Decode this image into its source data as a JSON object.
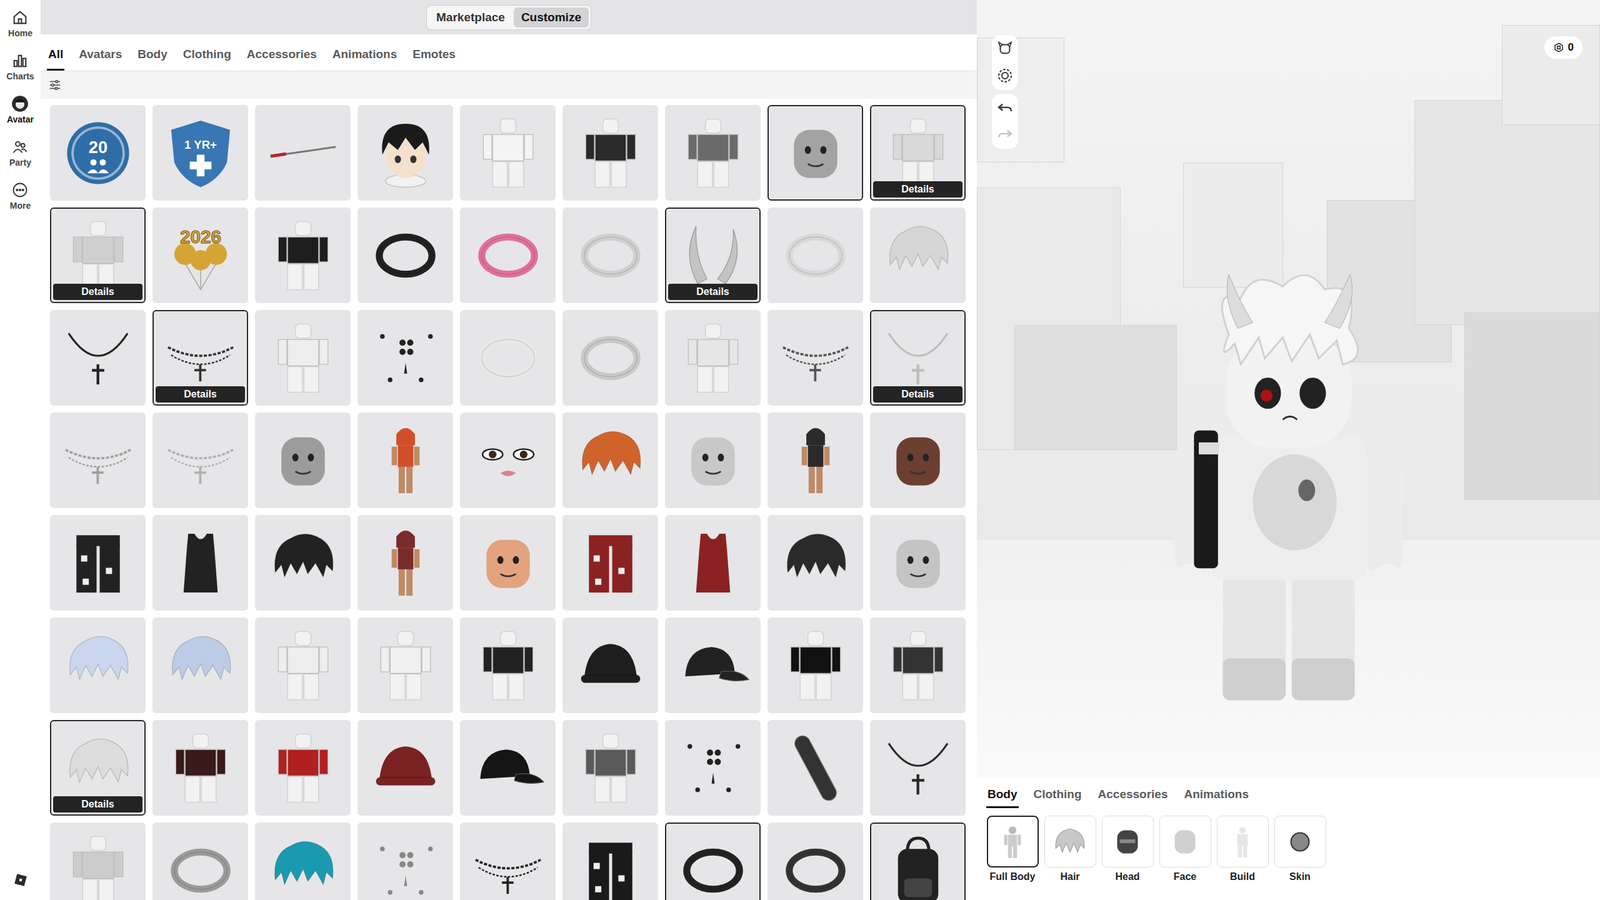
{
  "nav": {
    "items": [
      {
        "label": "Home",
        "kind": "home",
        "selected": false
      },
      {
        "label": "Charts",
        "kind": "charts",
        "selected": false
      },
      {
        "label": "Avatar",
        "kind": "avatar",
        "selected": true
      },
      {
        "label": "Party",
        "kind": "party",
        "selected": false
      },
      {
        "label": "More",
        "kind": "more",
        "selected": false
      }
    ]
  },
  "mode_toggle": [
    {
      "label": "Marketplace",
      "selected": false
    },
    {
      "label": "Customize",
      "selected": true
    }
  ],
  "tabs": [
    {
      "label": "All",
      "selected": true
    },
    {
      "label": "Avatars",
      "selected": false
    },
    {
      "label": "Body",
      "selected": false
    },
    {
      "label": "Clothing",
      "selected": false
    },
    {
      "label": "Accessories",
      "selected": false
    },
    {
      "label": "Animations",
      "selected": false
    },
    {
      "label": "Emotes",
      "selected": false
    }
  ],
  "grid": {
    "items": [
      {
        "kind": "coin",
        "color": "#2f6da6",
        "label": "20",
        "selected": false
      },
      {
        "kind": "shield",
        "color": "#3876b4",
        "label": "1 YR+",
        "selected": false
      },
      {
        "kind": "sword",
        "color": "#b02a2a",
        "selected": false
      },
      {
        "kind": "anime",
        "color": "#1a1a1a",
        "selected": false
      },
      {
        "kind": "avatar",
        "color": "#f4f4f4",
        "selected": false
      },
      {
        "kind": "avatar",
        "color": "#2a2a2a",
        "selected": false
      },
      {
        "kind": "avatar",
        "color": "#6a6a6a",
        "selected": false
      },
      {
        "kind": "head",
        "color": "#a3a3a3",
        "selected": true
      },
      {
        "kind": "avatar",
        "color": "#d9d9d9",
        "selected": true,
        "badge": "Details"
      },
      {
        "kind": "avatar",
        "color": "#cfcfcf",
        "selected": true,
        "badge": "Details"
      },
      {
        "kind": "balloons",
        "color": "#d4a535",
        "label": "2026",
        "selected": false
      },
      {
        "kind": "avatar",
        "color": "#1e1e1e",
        "selected": false
      },
      {
        "kind": "accessory",
        "color": "#222222",
        "selected": false
      },
      {
        "kind": "accessory",
        "color": "#e0709a",
        "selected": false
      },
      {
        "kind": "accessory",
        "color": "#cfcfcf",
        "selected": false
      },
      {
        "kind": "horns",
        "color": "#c4c4c4",
        "selected": true,
        "badge": "Details"
      },
      {
        "kind": "accessory",
        "color": "#d8d8d8",
        "selected": false
      },
      {
        "kind": "hair",
        "color": "#d6d6d6",
        "selected": false
      },
      {
        "kind": "necklace",
        "color": "#222222",
        "selected": false
      },
      {
        "kind": "chain",
        "color": "#333333",
        "selected": true,
        "badge": "Details"
      },
      {
        "kind": "avatar",
        "color": "#eeeeee",
        "selected": false
      },
      {
        "kind": "studs",
        "color": "#222222",
        "selected": false
      },
      {
        "kind": "accessory",
        "color": "#e8e8e8",
        "selected": false
      },
      {
        "kind": "accessory",
        "color": "#c8c8c8",
        "selected": false
      },
      {
        "kind": "avatar",
        "color": "#e6e6e6",
        "selected": false
      },
      {
        "kind": "chain",
        "color": "#555555",
        "selected": false
      },
      {
        "kind": "necklace",
        "color": "#bdbdbd",
        "selected": true,
        "badge": "Details"
      },
      {
        "kind": "chain",
        "color": "#a0a0a0",
        "selected": false
      },
      {
        "kind": "chain",
        "color": "#b0b0b0",
        "selected": false
      },
      {
        "kind": "head",
        "color": "#9c9c9c",
        "selected": false
      },
      {
        "kind": "body",
        "color": "#d0502a",
        "selected": false
      },
      {
        "kind": "face",
        "color": "#3a2a20",
        "selected": false
      },
      {
        "kind": "hair",
        "color": "#d0632a",
        "selected": false
      },
      {
        "kind": "head",
        "color": "#c8c8c8",
        "selected": false
      },
      {
        "kind": "body",
        "color": "#2a2a2a",
        "selected": false
      },
      {
        "kind": "head",
        "color": "#6b4030",
        "selected": false
      },
      {
        "kind": "pants",
        "color": "#222222",
        "selected": false
      },
      {
        "kind": "tank",
        "color": "#222222",
        "selected": false
      },
      {
        "kind": "hair",
        "color": "#222222",
        "selected": false
      },
      {
        "kind": "body",
        "color": "#7a2a2a",
        "selected": false
      },
      {
        "kind": "head",
        "color": "#e2a37e",
        "selected": false
      },
      {
        "kind": "pants",
        "color": "#8b2222",
        "selected": false
      },
      {
        "kind": "tank",
        "color": "#8b2222",
        "selected": false
      },
      {
        "kind": "hair",
        "color": "#2a2a2a",
        "selected": false
      },
      {
        "kind": "head",
        "color": "#c4c4c4",
        "selected": false
      },
      {
        "kind": "hair",
        "color": "#c9d6ee",
        "selected": false
      },
      {
        "kind": "hair",
        "color": "#bccbe6",
        "selected": false
      },
      {
        "kind": "avatar",
        "color": "#eeeeee",
        "selected": false
      },
      {
        "kind": "avatar",
        "color": "#f0f0f0",
        "selected": false
      },
      {
        "kind": "avatar",
        "color": "#222222",
        "selected": false
      },
      {
        "kind": "hat",
        "color": "#1e1e1e",
        "selected": false
      },
      {
        "kind": "cap",
        "color": "#222222",
        "selected": false
      },
      {
        "kind": "avatar",
        "color": "#111111",
        "selected": false
      },
      {
        "kind": "avatar",
        "color": "#333333",
        "selected": false
      },
      {
        "kind": "hair",
        "color": "#dcdcdc",
        "selected": true,
        "badge": "Details"
      },
      {
        "kind": "avatar",
        "color": "#3a1a1a",
        "selected": false
      },
      {
        "kind": "avatar",
        "color": "#b02020",
        "selected": false
      },
      {
        "kind": "hat",
        "color": "#7a2222",
        "selected": false
      },
      {
        "kind": "cap",
        "color": "#151515",
        "selected": false
      },
      {
        "kind": "avatar",
        "color": "#5a5a5a",
        "selected": false
      },
      {
        "kind": "studs",
        "color": "#222222",
        "selected": false
      },
      {
        "kind": "board",
        "color": "#333333",
        "selected": false
      },
      {
        "kind": "necklace",
        "color": "#2a2a2a",
        "selected": false
      },
      {
        "kind": "avatar",
        "color": "#cccccc",
        "selected": false
      },
      {
        "kind": "accessory",
        "color": "#9a9a9a",
        "selected": false
      },
      {
        "kind": "hair",
        "color": "#1a9ab0",
        "selected": false
      },
      {
        "kind": "studs",
        "color": "#888888",
        "selected": false
      },
      {
        "kind": "chain",
        "color": "#222222",
        "selected": false
      },
      {
        "kind": "pants",
        "color": "#1a1a1a",
        "selected": false
      },
      {
        "kind": "accessory",
        "color": "#222222",
        "selected": true
      },
      {
        "kind": "accessory",
        "color": "#333333",
        "selected": false
      },
      {
        "kind": "bag",
        "color": "#222222",
        "selected": true
      }
    ]
  },
  "viewport": {
    "currency": "0",
    "undo_enabled": true,
    "redo_enabled": false
  },
  "bottom_tabs": [
    {
      "label": "Body",
      "selected": true
    },
    {
      "label": "Clothing",
      "selected": false
    },
    {
      "label": "Accessories",
      "selected": false
    },
    {
      "label": "Animations",
      "selected": false
    }
  ],
  "categories": [
    {
      "label": "Full Body",
      "kind": "fullbody",
      "selected": true
    },
    {
      "label": "Hair",
      "kind": "hair",
      "selected": false
    },
    {
      "label": "Head",
      "kind": "head",
      "selected": false
    },
    {
      "label": "Face",
      "kind": "face",
      "selected": false
    },
    {
      "label": "Build",
      "kind": "build",
      "selected": false
    },
    {
      "label": "Skin",
      "kind": "skin",
      "selected": false
    }
  ]
}
